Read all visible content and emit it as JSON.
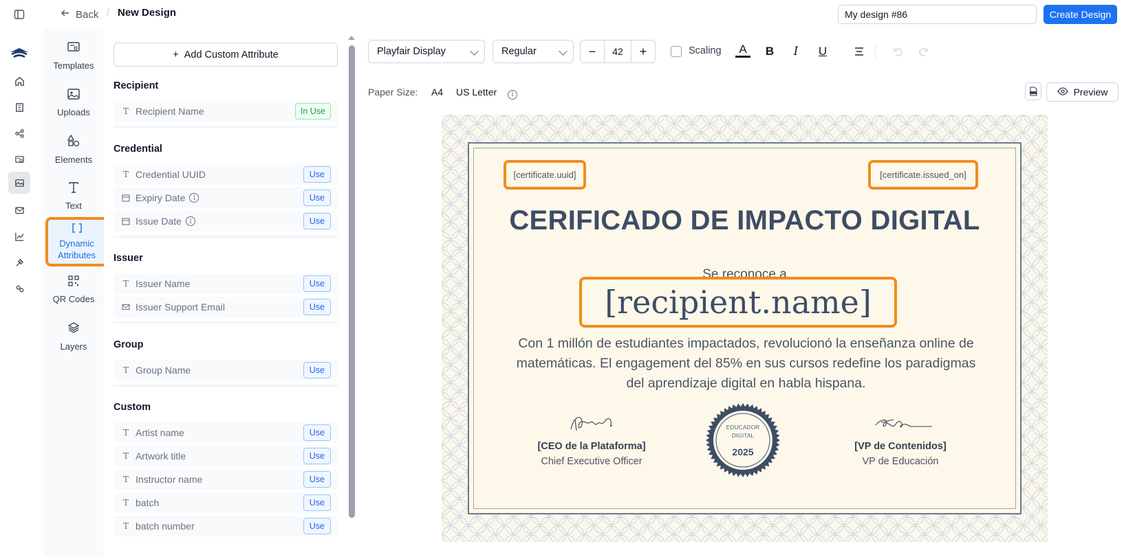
{
  "header": {
    "back_label": "Back",
    "separator": "/",
    "page_title": "New Design",
    "design_name_value": "My design #86",
    "create_label": "Create Design"
  },
  "tools": [
    {
      "label": "Templates",
      "icon": "templates-icon"
    },
    {
      "label": "Uploads",
      "icon": "image-icon"
    },
    {
      "label": "Elements",
      "icon": "shapes-icon"
    },
    {
      "label": "Text",
      "icon": "text-icon"
    },
    {
      "label": "Dynamic Attributes",
      "icon": "brackets-icon"
    },
    {
      "label": "QR Codes",
      "icon": "qr-code-icon"
    },
    {
      "label": "Layers",
      "icon": "layers-icon"
    }
  ],
  "attributes": {
    "add_label": "Add Custom Attribute",
    "use_label": "Use",
    "in_use_label": "In Use",
    "recipient": {
      "title": "Recipient",
      "items": [
        "Recipient Name"
      ]
    },
    "credential": {
      "title": "Credential",
      "items": [
        "Credential UUID",
        "Expiry Date",
        "Issue Date"
      ]
    },
    "issuer": {
      "title": "Issuer",
      "items": [
        "Issuer Name",
        "Issuer Support Email"
      ]
    },
    "group": {
      "title": "Group",
      "items": [
        "Group Name"
      ]
    },
    "custom": {
      "title": "Custom",
      "items": [
        "Artist name",
        "Artwork title",
        "Instructor name",
        "batch",
        "batch number"
      ]
    }
  },
  "toolbar": {
    "font_family": "Playfair Display",
    "font_weight": "Regular",
    "font_size": "42",
    "minus": "−",
    "plus": "+",
    "scaling_label": "Scaling",
    "bold": "B",
    "italic": "I",
    "underline": "U",
    "color_letter": "A"
  },
  "paper": {
    "label": "Paper Size:",
    "options": [
      "A4",
      "US Letter"
    ],
    "preview_label": "Preview"
  },
  "certificate": {
    "uuid_tag": "[certificate.uuid]",
    "issued_tag": "[certificate.issued_on]",
    "title": "CERIFICADO DE IMPACTO DIGITAL",
    "subtitle": "Se reconoce a",
    "recipient": "[recipient.name]",
    "body": "Con 1 millón de estudiantes impactados, revolucionó la enseñanza online de matemáticas. El engagement del 85% en sus cursos redefine los paradigmas del aprendizaje digital en habla hispana.",
    "seal_line1": "EDUCADOR",
    "seal_line2": "DIGITAL",
    "seal_year": "2025",
    "sig_left_name": "[CEO de la Plataforma]",
    "sig_left_role": "Chief Executive Officer",
    "sig_right_name": "[VP de Contenidos]",
    "sig_right_role": "VP de Educación"
  },
  "colors": {
    "accent": "#1d72f2",
    "highlight": "#f28c1c",
    "title": "#3e4d65"
  }
}
